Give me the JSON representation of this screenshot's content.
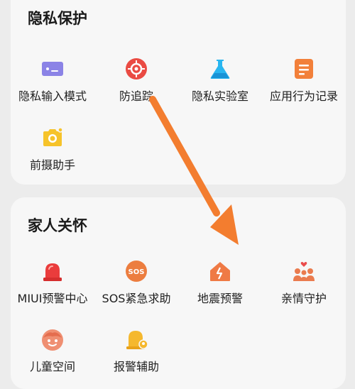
{
  "privacy": {
    "title": "隐私保护",
    "items": [
      {
        "label": "隐私输入模式",
        "icon": "keyboard-icon",
        "color": "#8b83e6"
      },
      {
        "label": "防追踪",
        "icon": "target-icon",
        "color": "#ea4b43"
      },
      {
        "label": "隐私实验室",
        "icon": "flask-icon",
        "color": "#29b6f0"
      },
      {
        "label": "应用行为记录",
        "icon": "document-icon",
        "color": "#f2803a"
      },
      {
        "label": "前摄助手",
        "icon": "front-camera-icon",
        "color": "#f6c32a"
      }
    ]
  },
  "family": {
    "title": "家人关怀",
    "items": [
      {
        "label": "MIUI预警中心",
        "icon": "alarm-light-icon",
        "color": "#ea3c3c"
      },
      {
        "label": "SOS紧急求助",
        "icon": "sos-icon",
        "color": "#ec7d3f"
      },
      {
        "label": "地震预警",
        "icon": "earthquake-house-icon",
        "color": "#ef7a45"
      },
      {
        "label": "亲情守护",
        "icon": "family-icon",
        "color": "#ea7b4e"
      },
      {
        "label": "儿童空间",
        "icon": "child-face-icon",
        "color": "#ef8f72"
      },
      {
        "label": "报警辅助",
        "icon": "police-bell-icon",
        "color": "#f5b82e"
      }
    ]
  },
  "arrow": {
    "color": "#f37d2f"
  }
}
